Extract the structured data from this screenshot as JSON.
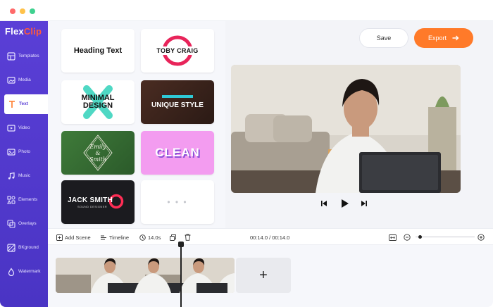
{
  "app": {
    "logo_main": "Flex",
    "logo_accent": "Clip"
  },
  "sidebar": {
    "items": [
      {
        "label": "Templates",
        "icon": "templates-icon"
      },
      {
        "label": "Media",
        "icon": "media-icon"
      },
      {
        "label": "Text",
        "icon": "text-icon",
        "active": true
      },
      {
        "label": "Video",
        "icon": "video-icon"
      },
      {
        "label": "Photo",
        "icon": "photo-icon"
      },
      {
        "label": "Music",
        "icon": "music-icon"
      },
      {
        "label": "Elements",
        "icon": "elements-icon"
      },
      {
        "label": "Overlays",
        "icon": "overlays-icon"
      },
      {
        "label": "BKground",
        "icon": "background-icon"
      },
      {
        "label": "Watermark",
        "icon": "watermark-icon"
      }
    ]
  },
  "text_templates": {
    "heading": "Heading Text",
    "toby_name": "TOBY CRAIG",
    "minimal_line1": "MINIMAL",
    "minimal_line2": "DESIGN",
    "unique_style": "UNIQUE STYLE",
    "emily_line1": "Emily",
    "emily_amp": "&",
    "emily_line2": "Smith",
    "clean": "CLEAN",
    "jack_name": "JACK SMITH",
    "jack_sub": "SOUND DESIGNER",
    "more": "• • •"
  },
  "header": {
    "save_label": "Save",
    "export_label": "Export",
    "export_icon": "arrow-right-icon"
  },
  "toolbar": {
    "add_scene": "Add Scene",
    "timeline": "Timeline",
    "duration": "14.0s",
    "time_readout": "00:14.0 / 00:14.0"
  },
  "timeline": {
    "add_symbol": "+"
  },
  "colors": {
    "brand_purple": "#5a3fd6",
    "accent_orange": "#ff7a29",
    "logo_red": "#ff5a3c"
  }
}
